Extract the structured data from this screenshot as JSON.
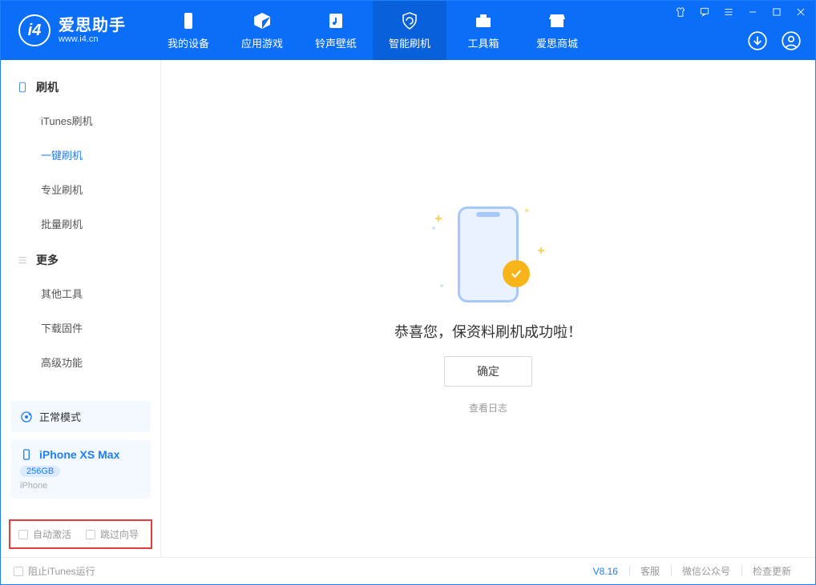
{
  "app": {
    "title": "爱思助手",
    "subtitle": "www.i4.cn"
  },
  "nav": {
    "tabs": [
      {
        "label": "我的设备"
      },
      {
        "label": "应用游戏"
      },
      {
        "label": "铃声壁纸"
      },
      {
        "label": "智能刷机"
      },
      {
        "label": "工具箱"
      },
      {
        "label": "爱思商城"
      }
    ]
  },
  "sidebar": {
    "group1": {
      "title": "刷机",
      "items": [
        "iTunes刷机",
        "一键刷机",
        "专业刷机",
        "批量刷机"
      ]
    },
    "group2": {
      "title": "更多",
      "items": [
        "其他工具",
        "下载固件",
        "高级功能"
      ]
    },
    "mode": {
      "label": "正常模式"
    },
    "device": {
      "name": "iPhone XS Max",
      "capacity": "256GB",
      "type": "iPhone"
    },
    "options": {
      "auto_activate": "自动激活",
      "skip_guide": "跳过向导"
    }
  },
  "main": {
    "success_msg": "恭喜您，保资料刷机成功啦！",
    "ok_button": "确定",
    "view_log": "查看日志"
  },
  "statusbar": {
    "prevent_itunes": "阻止iTunes运行",
    "version": "V8.16",
    "links": [
      "客服",
      "微信公众号",
      "检查更新"
    ]
  }
}
